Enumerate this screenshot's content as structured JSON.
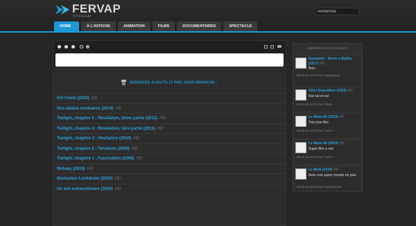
{
  "brand": {
    "name": "FERVAP",
    "tagline": "STREAM",
    "accent": "#1d9ad6"
  },
  "search": {
    "label": "",
    "value": "recherche"
  },
  "nav": [
    {
      "label": "HOME",
      "active": true
    },
    {
      "label": "À L'AFFICHE"
    },
    {
      "label": "ANIMATION"
    },
    {
      "label": "FILMS"
    },
    {
      "label": "DOCUMENTAIRES"
    },
    {
      "label": "SPECTACLE"
    }
  ],
  "list": {
    "heading": "DERNIERS AJOUTS (3 PAR JOUR MINIMUM) :",
    "items": [
      {
        "title": "Kill Chain (2020)",
        "badge": "HD"
      },
      {
        "title": "Nos étoiles contraires (2014)",
        "badge": "HD"
      },
      {
        "title": "Twilight, chapitre 5 : Révélation, 2ème partie (2012)",
        "badge": "HD"
      },
      {
        "title": "Twilight, chapitre 4 : Révélation, 1ère partie (2011)",
        "badge": "HD"
      },
      {
        "title": "Twilight, chapitre 3 : Hésitation (2010)",
        "badge": "HD"
      },
      {
        "title": "Twilight, chapitre 2 : Tentation (2009)",
        "badge": "HD"
      },
      {
        "title": "Twilight, chapitre 1 : Fascination (2008)",
        "badge": "HD"
      },
      {
        "title": "Midway (2019)",
        "badge": "HD"
      },
      {
        "title": "Manhattan Lockdown (2020)",
        "badge": "HD"
      },
      {
        "title": "Un ami extraordinaire (2020)",
        "badge": "HD"
      }
    ]
  },
  "sidebar": {
    "title": "DERNIERES CRITIQUES",
    "reviews": [
      {
        "title": "Baywatch : Alerte à Malibu (2017)",
        "badge": "HD",
        "text": "Bien",
        "meta": "05.02.20 14:19 Par Uyyyyyyyyy"
      },
      {
        "title": "Alien Expedition (2020)",
        "badge": "HD",
        "text": "Nul nul et nul",
        "meta": "05.02.20 12:11 Par Omar"
      },
      {
        "title": "Le Mans 66 (2019)",
        "badge": "HD",
        "text": "Très bon film",
        "meta": "05.02.20 11:34 Par Yoann"
      },
      {
        "title": "Le Mans 66 (2019)",
        "badge": "HD",
        "text": "Super film a voir",
        "meta": "05.02.20 11:33 Par Yoann"
      },
      {
        "title": "Le Mule (2019)",
        "badge": "HD",
        "text": "Avec une super morale en plus",
        "meta": "05.02.20 09:59 Par Tony.Burnett"
      }
    ]
  }
}
